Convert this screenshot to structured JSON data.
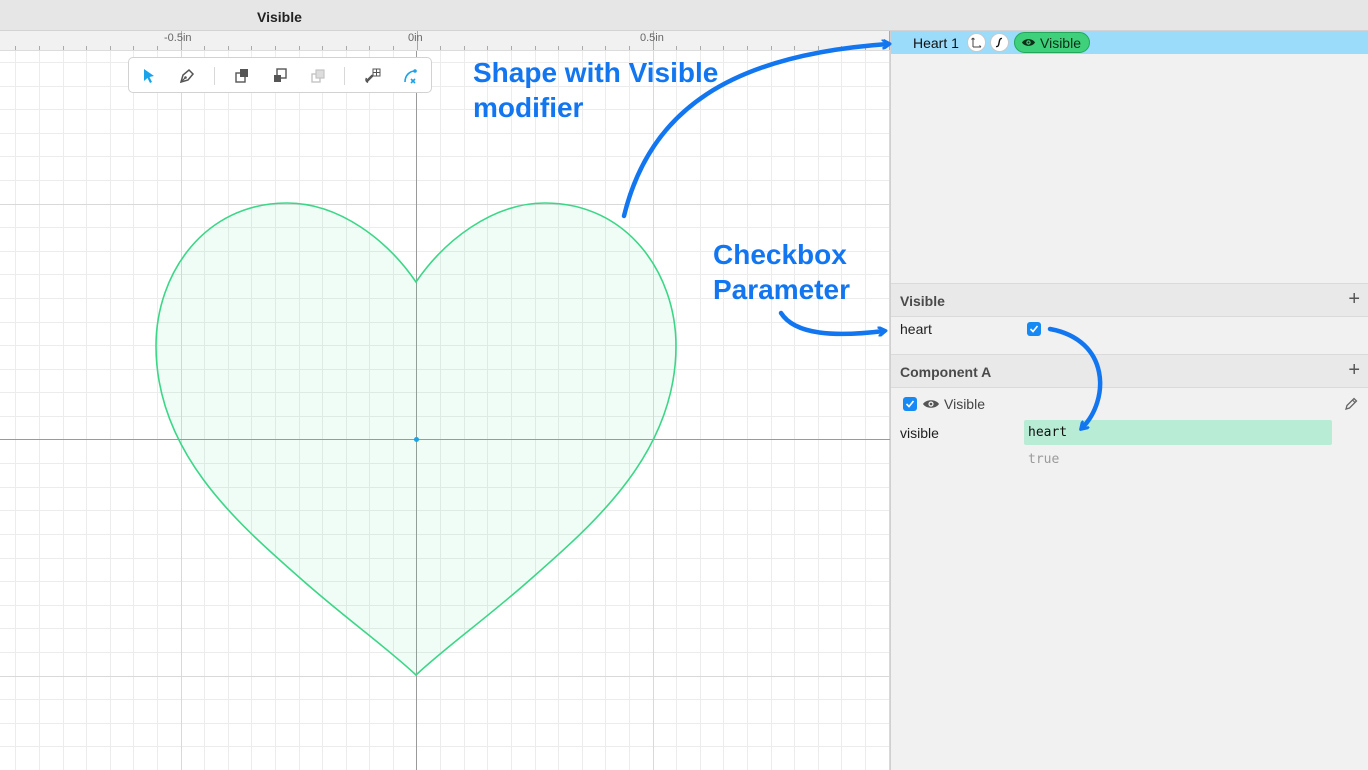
{
  "window": {
    "title": "Visible"
  },
  "ruler": {
    "labels": [
      "-0.5in",
      "0in",
      "0.5in"
    ]
  },
  "toolbar": {
    "tools": [
      {
        "name": "select-tool",
        "icon": "arrow-cursor-icon",
        "active": true
      },
      {
        "name": "pen-tool",
        "icon": "pen-nib-icon",
        "active": false
      },
      {
        "name": "bring-forward-tool",
        "icon": "layer-forward-icon",
        "active": false
      },
      {
        "name": "send-backward-tool",
        "icon": "layer-backward-icon",
        "active": false
      },
      {
        "name": "boolean-tool",
        "icon": "layer-disabled-icon",
        "active": false
      },
      {
        "name": "snap-grid-tool",
        "icon": "magnet-grid-icon",
        "active": false
      },
      {
        "name": "snap-point-tool",
        "icon": "magnet-point-icon",
        "active": true
      }
    ]
  },
  "layers": {
    "selected": {
      "name": "Heart 1",
      "modifier_label": "Visible"
    }
  },
  "parameters": {
    "title": "Visible",
    "items": [
      {
        "name": "heart",
        "checked": true
      }
    ]
  },
  "component": {
    "title": "Component A",
    "modifier": {
      "label": "Visible",
      "enabled": true
    },
    "properties": [
      {
        "name": "visible",
        "expression": "heart",
        "value": "true"
      }
    ]
  },
  "annotations": {
    "shape": [
      "Shape with Visible",
      "modifier"
    ],
    "checkbox": [
      "Checkbox",
      "Parameter"
    ]
  },
  "colors": {
    "accent": "#1276f0",
    "selection": "#9bdcfa",
    "modifier_badge": "#3ed07a",
    "heart_stroke": "#3bd787",
    "expression_bg": "#b8ecd5"
  }
}
